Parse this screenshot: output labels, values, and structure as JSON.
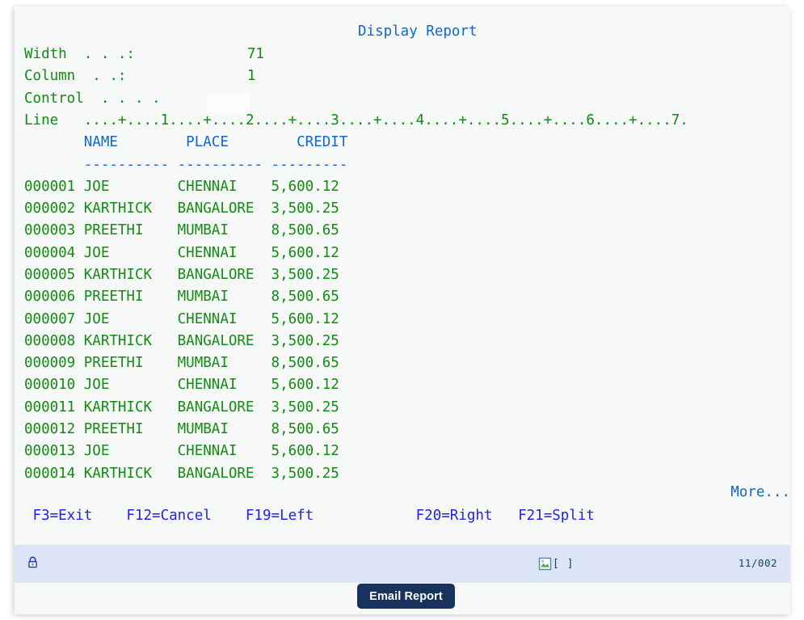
{
  "screen": {
    "title": "Display Report",
    "fields": [
      {
        "label": "Width  . . .:",
        "value": "71"
      },
      {
        "label": "Column  . .:",
        "value": "1"
      },
      {
        "label": "Control  . . . .",
        "value": ""
      }
    ],
    "ruler_label": "Line   ",
    "ruler": "....+....1....+....2....+....3....+....4....+....5....+....6....+....7.",
    "columns": {
      "header_line": "       NAME        PLACE        CREDIT",
      "dash_line": "       ---------- ---------- ---------"
    },
    "column_headers": [
      "NAME",
      "PLACE",
      "CREDIT"
    ],
    "rows": [
      {
        "seq": "000001",
        "name": "JOE",
        "place": "CHENNAI",
        "credit": "5,600.12"
      },
      {
        "seq": "000002",
        "name": "KARTHICK",
        "place": "BANGALORE",
        "credit": "3,500.25"
      },
      {
        "seq": "000003",
        "name": "PREETHI",
        "place": "MUMBAI",
        "credit": "8,500.65"
      },
      {
        "seq": "000004",
        "name": "JOE",
        "place": "CHENNAI",
        "credit": "5,600.12"
      },
      {
        "seq": "000005",
        "name": "KARTHICK",
        "place": "BANGALORE",
        "credit": "3,500.25"
      },
      {
        "seq": "000006",
        "name": "PREETHI",
        "place": "MUMBAI",
        "credit": "8,500.65"
      },
      {
        "seq": "000007",
        "name": "JOE",
        "place": "CHENNAI",
        "credit": "5,600.12"
      },
      {
        "seq": "000008",
        "name": "KARTHICK",
        "place": "BANGALORE",
        "credit": "3,500.25"
      },
      {
        "seq": "000009",
        "name": "PREETHI",
        "place": "MUMBAI",
        "credit": "8,500.65"
      },
      {
        "seq": "000010",
        "name": "JOE",
        "place": "CHENNAI",
        "credit": "5,600.12"
      },
      {
        "seq": "000011",
        "name": "KARTHICK",
        "place": "BANGALORE",
        "credit": "3,500.25"
      },
      {
        "seq": "000012",
        "name": "PREETHI",
        "place": "MUMBAI",
        "credit": "8,500.65"
      },
      {
        "seq": "000013",
        "name": "JOE",
        "place": "CHENNAI",
        "credit": "5,600.12"
      },
      {
        "seq": "000014",
        "name": "KARTHICK",
        "place": "BANGALORE",
        "credit": "3,500.25"
      }
    ],
    "more_indicator": "More...",
    "function_keys_line": " F3=Exit    F12=Cancel    F19=Left            F20=Right   F21=Split",
    "function_keys": [
      {
        "key": "F3",
        "label": "F3=Exit"
      },
      {
        "key": "F12",
        "label": "F12=Cancel"
      },
      {
        "key": "F19",
        "label": "F19=Left"
      },
      {
        "key": "F20",
        "label": "F20=Right"
      },
      {
        "key": "F21",
        "label": "F21=Split"
      }
    ]
  },
  "statusbar": {
    "lock_icon": "lock-icon",
    "middle_icon": "broken-image-icon",
    "middle_text": "[ ]",
    "position": "11/002"
  },
  "footer": {
    "email_button": "Email Report"
  },
  "colors": {
    "green_text": "#148a14",
    "blue_text": "#1266cc",
    "fkey_blue": "#2222ee",
    "screen_bg": "#f7f8f8",
    "statusbar_bg": "#dbe5f5",
    "button_bg": "#17325c"
  }
}
